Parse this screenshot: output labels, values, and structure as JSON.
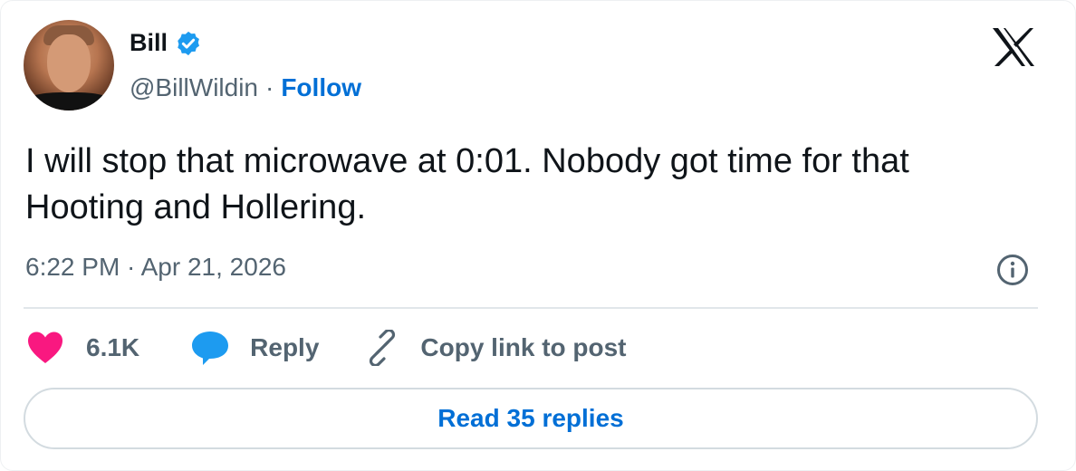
{
  "author": {
    "name": "Bill",
    "handle": "@BillWildin",
    "separator": "·",
    "follow_label": "Follow",
    "verified": true
  },
  "tweet": {
    "text": "I will stop that microwave at 0:01. Nobody got time for that Hooting and Hollering.",
    "timestamp": "6:22 PM · Apr 21, 2026"
  },
  "actions": {
    "like_count": "6.1K",
    "reply_label": "Reply",
    "copy_link_label": "Copy link to post"
  },
  "read_replies_label": "Read 35 replies",
  "colors": {
    "link_blue": "#006fd6",
    "verified_blue": "#1d9bf0",
    "heart_pink": "#f91880",
    "reply_blue": "#1d9bf0",
    "muted_text": "#536471"
  },
  "icons": {
    "brand": "x-logo-icon",
    "verified": "verified-badge-icon",
    "info": "info-icon",
    "like": "heart-icon",
    "reply": "speech-bubble-icon",
    "copy": "link-icon"
  }
}
